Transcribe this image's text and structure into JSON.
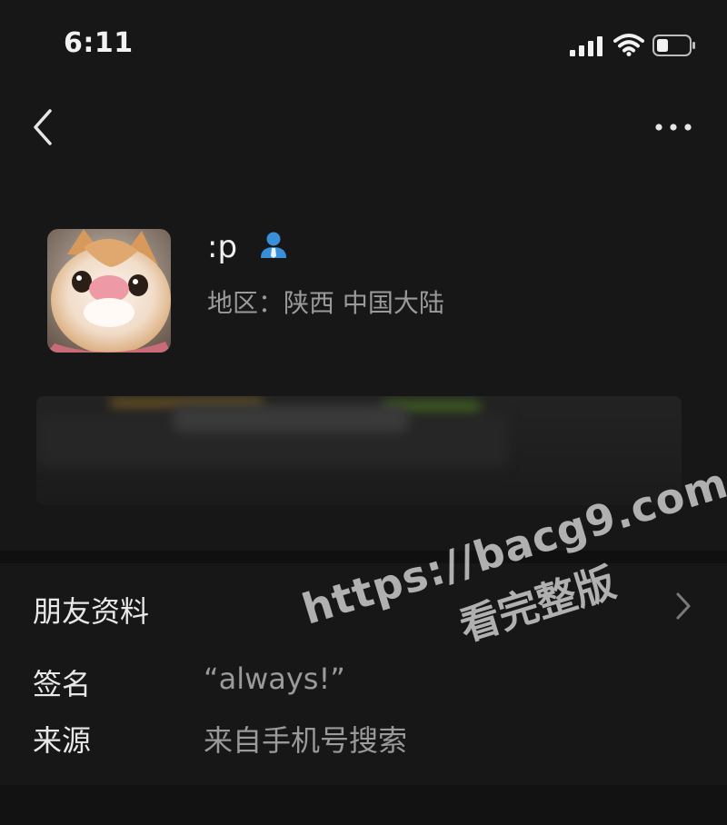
{
  "status_bar": {
    "time": "6:11",
    "icons": [
      "cellular-signal-icon",
      "wifi-icon",
      "battery-icon"
    ]
  },
  "nav": {
    "back_icon": "chevron-left-icon",
    "more_icon": "more-horizontal-icon"
  },
  "profile": {
    "nickname": ":p",
    "badge_icon": "person-badge-icon",
    "region_label": "地区：",
    "region_value": "陕西 中国大陆",
    "colors": {
      "badge": "#3a8fd9"
    }
  },
  "friend_info": {
    "label": "朋友资料",
    "chevron_icon": "chevron-right-icon"
  },
  "details": {
    "signature_label": "签名",
    "signature_value": "“always!”",
    "source_label": "来源",
    "source_value": "来自手机号搜索"
  },
  "watermark": {
    "url": "https://bacg9.com",
    "subtitle": "看完整版"
  }
}
